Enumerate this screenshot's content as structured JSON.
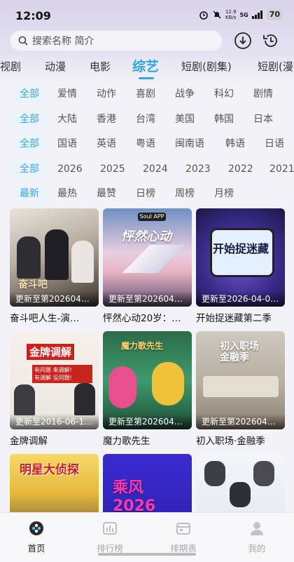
{
  "status": {
    "time": "12:09",
    "speed_top": "12.9",
    "speed_bottom": "KB/s",
    "network": "5G",
    "battery": "70"
  },
  "search": {
    "placeholder": "搜索名称 简介"
  },
  "tabs": [
    {
      "label": "视剧"
    },
    {
      "label": "动漫"
    },
    {
      "label": "电影"
    },
    {
      "label": "综艺"
    },
    {
      "label": "短剧(剧集)"
    },
    {
      "label": "短剧(漫"
    }
  ],
  "filters": {
    "genre": [
      "全部",
      "爱情",
      "动作",
      "喜剧",
      "战争",
      "科幻",
      "剧情"
    ],
    "region": [
      "全部",
      "大陆",
      "香港",
      "台湾",
      "美国",
      "韩国",
      "日本"
    ],
    "language": [
      "全部",
      "国语",
      "英语",
      "粤语",
      "闽南语",
      "韩语",
      "日语"
    ],
    "year": [
      "全部",
      "2026",
      "2025",
      "2024",
      "2023",
      "2022",
      "2021"
    ],
    "sort": [
      "最新",
      "最热",
      "最赞",
      "日榜",
      "周榜",
      "月榜"
    ]
  },
  "cards": [
    {
      "title": "奋斗吧人生-演…",
      "badge": "更新至第202604…",
      "poster_text": "奋斗吧"
    },
    {
      "title": "怦然心动20岁：…",
      "badge": "更新至第202604…",
      "poster_text": "怦然心动",
      "logo": "Soul APP"
    },
    {
      "title": "开始捉迷藏第二季",
      "badge": "更新至2026-04-0…",
      "poster_text": "开始捉迷藏"
    },
    {
      "title": "金牌调解",
      "badge": "更新至2016-06-1…",
      "poster_text": "金牌调解",
      "poster_sub1": "有问题 来调解!",
      "poster_sub2": "有调解 没问题!"
    },
    {
      "title": "魔力歌先生",
      "badge": "更新至第202604…",
      "poster_text": "魔力歌先生"
    },
    {
      "title": "初入职场·金融季",
      "badge": "更新至第202604…",
      "poster_text": "初入职场 金融季"
    },
    {
      "title": "",
      "badge": "",
      "poster_text": "明星大侦探"
    },
    {
      "title": "",
      "badge": "",
      "poster_text": "乘风 2026"
    },
    {
      "title": "",
      "badge": "",
      "poster_text": ""
    }
  ],
  "nav": [
    {
      "label": "首页"
    },
    {
      "label": "排行榜"
    },
    {
      "label": "排期表"
    },
    {
      "label": "我的"
    }
  ],
  "colors": {
    "accent": "#2ea6d9",
    "chip_bg": "#eaf4fa"
  }
}
